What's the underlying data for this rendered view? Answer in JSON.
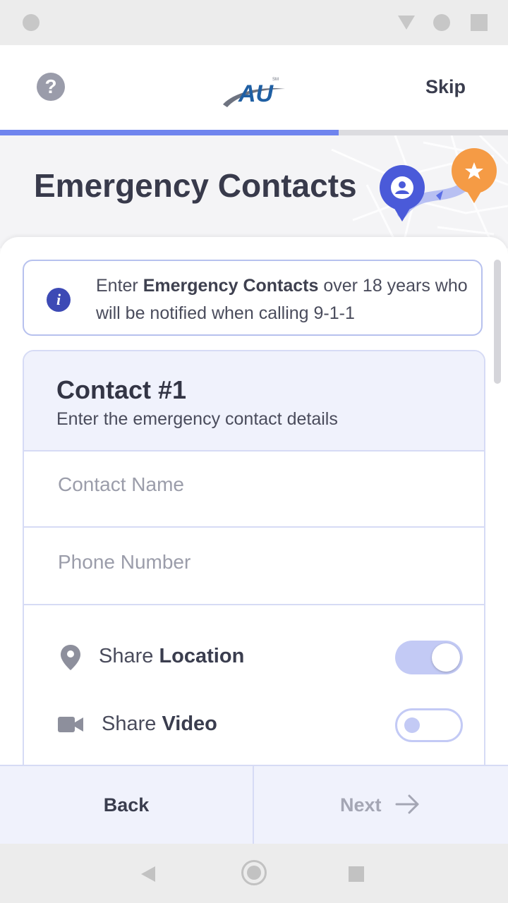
{
  "header": {
    "help_glyph": "?",
    "skip_label": "Skip"
  },
  "progress": {
    "fraction": 0.667,
    "fill_color": "#6f84ee"
  },
  "page": {
    "title": "Emergency Contacts"
  },
  "info": {
    "prefix": "Enter ",
    "bold": "Emergency Contacts",
    "suffix": " over 18 years who will be notified when calling 9-1-1",
    "icon": "info-icon"
  },
  "contact": {
    "title": "Contact #1",
    "subtitle": "Enter the emergency contact details",
    "name_placeholder": "Contact Name",
    "phone_placeholder": "Phone Number",
    "toggles": [
      {
        "prefix": "Share ",
        "bold": "Location",
        "icon": "location-pin-icon",
        "on": true
      },
      {
        "prefix": "Share ",
        "bold": "Video",
        "icon": "video-camera-icon",
        "on": false
      }
    ]
  },
  "footer": {
    "back_label": "Back",
    "next_label": "Next"
  },
  "colors": {
    "accent": "#5a6ee6",
    "badge_orange": "#f59b45",
    "text": "#3a3d4e"
  }
}
